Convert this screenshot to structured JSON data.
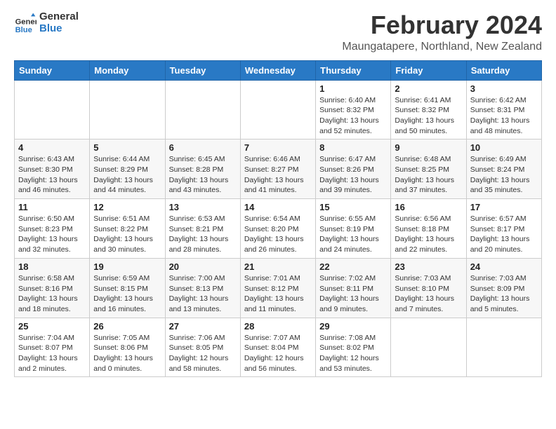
{
  "logo": {
    "text_general": "General",
    "text_blue": "Blue"
  },
  "header": {
    "month": "February 2024",
    "location": "Maungatapere, Northland, New Zealand"
  },
  "weekdays": [
    "Sunday",
    "Monday",
    "Tuesday",
    "Wednesday",
    "Thursday",
    "Friday",
    "Saturday"
  ],
  "weeks": [
    [
      {
        "day": "",
        "info": ""
      },
      {
        "day": "",
        "info": ""
      },
      {
        "day": "",
        "info": ""
      },
      {
        "day": "",
        "info": ""
      },
      {
        "day": "1",
        "info": "Sunrise: 6:40 AM\nSunset: 8:32 PM\nDaylight: 13 hours\nand 52 minutes."
      },
      {
        "day": "2",
        "info": "Sunrise: 6:41 AM\nSunset: 8:32 PM\nDaylight: 13 hours\nand 50 minutes."
      },
      {
        "day": "3",
        "info": "Sunrise: 6:42 AM\nSunset: 8:31 PM\nDaylight: 13 hours\nand 48 minutes."
      }
    ],
    [
      {
        "day": "4",
        "info": "Sunrise: 6:43 AM\nSunset: 8:30 PM\nDaylight: 13 hours\nand 46 minutes."
      },
      {
        "day": "5",
        "info": "Sunrise: 6:44 AM\nSunset: 8:29 PM\nDaylight: 13 hours\nand 44 minutes."
      },
      {
        "day": "6",
        "info": "Sunrise: 6:45 AM\nSunset: 8:28 PM\nDaylight: 13 hours\nand 43 minutes."
      },
      {
        "day": "7",
        "info": "Sunrise: 6:46 AM\nSunset: 8:27 PM\nDaylight: 13 hours\nand 41 minutes."
      },
      {
        "day": "8",
        "info": "Sunrise: 6:47 AM\nSunset: 8:26 PM\nDaylight: 13 hours\nand 39 minutes."
      },
      {
        "day": "9",
        "info": "Sunrise: 6:48 AM\nSunset: 8:25 PM\nDaylight: 13 hours\nand 37 minutes."
      },
      {
        "day": "10",
        "info": "Sunrise: 6:49 AM\nSunset: 8:24 PM\nDaylight: 13 hours\nand 35 minutes."
      }
    ],
    [
      {
        "day": "11",
        "info": "Sunrise: 6:50 AM\nSunset: 8:23 PM\nDaylight: 13 hours\nand 32 minutes."
      },
      {
        "day": "12",
        "info": "Sunrise: 6:51 AM\nSunset: 8:22 PM\nDaylight: 13 hours\nand 30 minutes."
      },
      {
        "day": "13",
        "info": "Sunrise: 6:53 AM\nSunset: 8:21 PM\nDaylight: 13 hours\nand 28 minutes."
      },
      {
        "day": "14",
        "info": "Sunrise: 6:54 AM\nSunset: 8:20 PM\nDaylight: 13 hours\nand 26 minutes."
      },
      {
        "day": "15",
        "info": "Sunrise: 6:55 AM\nSunset: 8:19 PM\nDaylight: 13 hours\nand 24 minutes."
      },
      {
        "day": "16",
        "info": "Sunrise: 6:56 AM\nSunset: 8:18 PM\nDaylight: 13 hours\nand 22 minutes."
      },
      {
        "day": "17",
        "info": "Sunrise: 6:57 AM\nSunset: 8:17 PM\nDaylight: 13 hours\nand 20 minutes."
      }
    ],
    [
      {
        "day": "18",
        "info": "Sunrise: 6:58 AM\nSunset: 8:16 PM\nDaylight: 13 hours\nand 18 minutes."
      },
      {
        "day": "19",
        "info": "Sunrise: 6:59 AM\nSunset: 8:15 PM\nDaylight: 13 hours\nand 16 minutes."
      },
      {
        "day": "20",
        "info": "Sunrise: 7:00 AM\nSunset: 8:13 PM\nDaylight: 13 hours\nand 13 minutes."
      },
      {
        "day": "21",
        "info": "Sunrise: 7:01 AM\nSunset: 8:12 PM\nDaylight: 13 hours\nand 11 minutes."
      },
      {
        "day": "22",
        "info": "Sunrise: 7:02 AM\nSunset: 8:11 PM\nDaylight: 13 hours\nand 9 minutes."
      },
      {
        "day": "23",
        "info": "Sunrise: 7:03 AM\nSunset: 8:10 PM\nDaylight: 13 hours\nand 7 minutes."
      },
      {
        "day": "24",
        "info": "Sunrise: 7:03 AM\nSunset: 8:09 PM\nDaylight: 13 hours\nand 5 minutes."
      }
    ],
    [
      {
        "day": "25",
        "info": "Sunrise: 7:04 AM\nSunset: 8:07 PM\nDaylight: 13 hours\nand 2 minutes."
      },
      {
        "day": "26",
        "info": "Sunrise: 7:05 AM\nSunset: 8:06 PM\nDaylight: 13 hours\nand 0 minutes."
      },
      {
        "day": "27",
        "info": "Sunrise: 7:06 AM\nSunset: 8:05 PM\nDaylight: 12 hours\nand 58 minutes."
      },
      {
        "day": "28",
        "info": "Sunrise: 7:07 AM\nSunset: 8:04 PM\nDaylight: 12 hours\nand 56 minutes."
      },
      {
        "day": "29",
        "info": "Sunrise: 7:08 AM\nSunset: 8:02 PM\nDaylight: 12 hours\nand 53 minutes."
      },
      {
        "day": "",
        "info": ""
      },
      {
        "day": "",
        "info": ""
      }
    ]
  ]
}
